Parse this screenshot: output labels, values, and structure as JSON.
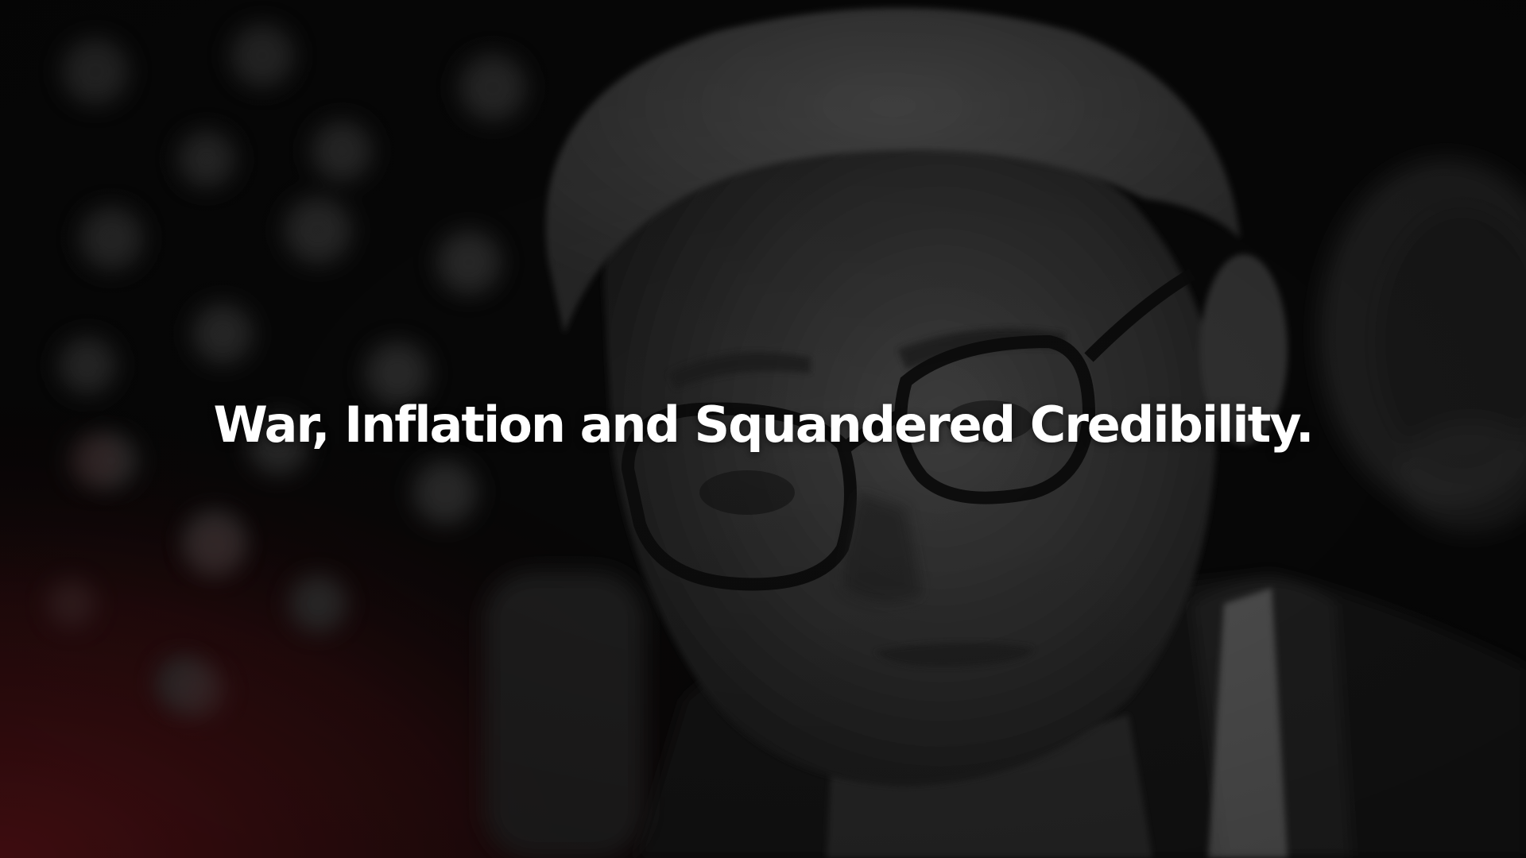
{
  "headline": "War, Inflation and Squandered Credibility.",
  "colors": {
    "background": "#0d0d0d",
    "flag_red": "#7a1a1e",
    "text": "#ffffff"
  }
}
